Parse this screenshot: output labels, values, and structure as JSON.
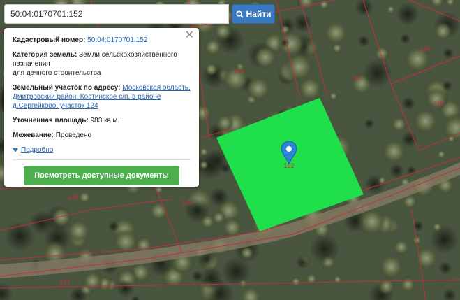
{
  "search": {
    "value": "50:04:0170701:152",
    "button_label": "Найти"
  },
  "panel": {
    "cadastral_label": "Кадастровый номер:",
    "cadastral_value": "50:04:0170701:152",
    "category_label": "Категория земель:",
    "category_value": "Земли сельскохозяйственного назначения",
    "category_value_2": "для дачного строительства",
    "address_label": "Земельный участок по адресу:",
    "address_value": "Московская область, Дмитровский район, Костинское с/п, в районе д.Сергейково, участок 124",
    "area_label": "Уточненная площадь:",
    "area_value": "983 кв.м.",
    "survey_label": "Межевание:",
    "survey_value": "Проведено",
    "more_link": "Подробно",
    "docs_button": "Посмотреть доступные документы"
  },
  "map": {
    "plot_labels": [
      "148",
      "153",
      "84",
      "162",
      "140",
      "165",
      "161",
      "152"
    ],
    "selected_color": "#1fe04a",
    "boundary_color": "#c0303c",
    "marker_color": "#2b86d6"
  }
}
